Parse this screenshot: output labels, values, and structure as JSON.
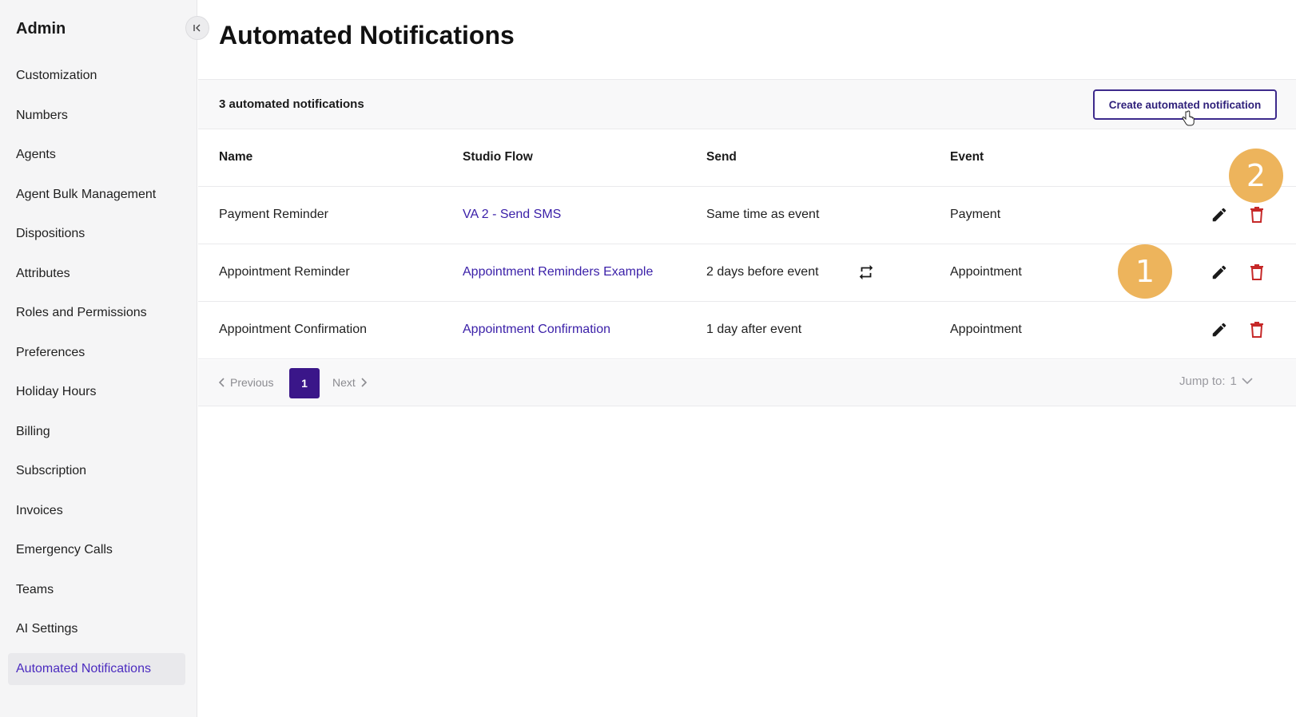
{
  "sidebar": {
    "title": "Admin",
    "collapse_glyph": "I<",
    "items": [
      {
        "label": "Customization"
      },
      {
        "label": "Numbers"
      },
      {
        "label": "Agents"
      },
      {
        "label": "Agent Bulk Management"
      },
      {
        "label": "Dispositions"
      },
      {
        "label": "Attributes"
      },
      {
        "label": "Roles and Permissions"
      },
      {
        "label": "Preferences"
      },
      {
        "label": "Holiday Hours"
      },
      {
        "label": "Billing"
      },
      {
        "label": "Subscription"
      },
      {
        "label": "Invoices"
      },
      {
        "label": "Emergency Calls"
      },
      {
        "label": "Teams"
      },
      {
        "label": "AI Settings"
      },
      {
        "label": "Automated Notifications"
      }
    ],
    "active_item": "Automated Notifications"
  },
  "main": {
    "title": "Automated Notifications",
    "count_label": "3 automated notifications",
    "create_button": "Create automated notification",
    "columns": {
      "name": "Name",
      "studio_flow": "Studio Flow",
      "send": "Send",
      "event": "Event"
    },
    "rows": [
      {
        "name": "Payment Reminder",
        "studio_flow": "VA 2 - Send SMS",
        "send": "Same time as event",
        "repeats": false,
        "event": "Payment"
      },
      {
        "name": "Appointment Reminder",
        "studio_flow": "Appointment Reminders Example",
        "send": "2 days before event",
        "repeats": true,
        "event": "Appointment"
      },
      {
        "name": "Appointment Confirmation",
        "studio_flow": "Appointment Confirmation",
        "send": "1 day after event",
        "repeats": false,
        "event": "Appointment"
      }
    ],
    "pagination": {
      "previous": "Previous",
      "current_page": "1",
      "next": "Next",
      "jump_label": "Jump to:",
      "jump_value": "1"
    }
  },
  "callouts": [
    {
      "label": "1"
    },
    {
      "label": "2"
    }
  ],
  "colors": {
    "accent": "#3a1689",
    "link": "#3a1fa8",
    "delete": "#c62828",
    "callout": "#edb45c"
  }
}
